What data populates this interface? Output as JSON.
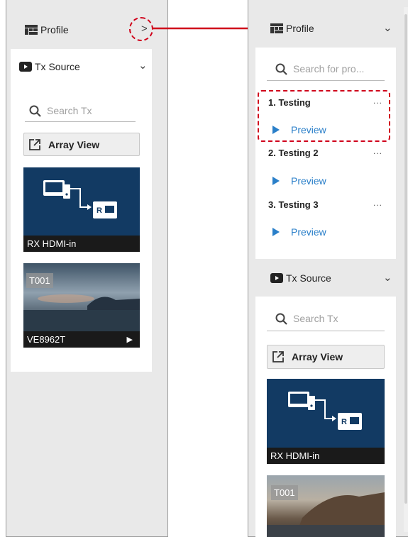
{
  "left": {
    "profile": {
      "label": "Profile",
      "chevron": ">"
    },
    "tx_source": {
      "label": "Tx Source",
      "chevron": "⌄"
    },
    "search": {
      "placeholder": "Search Tx"
    },
    "array_view": {
      "label": "Array View"
    },
    "thumbs": [
      {
        "caption": "RX HDMI-in"
      },
      {
        "tag": "T001",
        "caption": "VE8962T",
        "play": "▶"
      }
    ]
  },
  "right": {
    "profile": {
      "label": "Profile",
      "chevron": "⌄"
    },
    "search": {
      "placeholder": "Search for pro..."
    },
    "profiles": [
      {
        "name": "1. Testing",
        "more": "...",
        "preview": "Preview"
      },
      {
        "name": "2. Testing 2",
        "more": "...",
        "preview": "Preview"
      },
      {
        "name": "3. Testing 3",
        "more": "...",
        "preview": "Preview"
      }
    ],
    "tx_source": {
      "label": "Tx Source",
      "chevron": "⌄"
    },
    "tx_search": {
      "placeholder": "Search Tx"
    },
    "array_view": {
      "label": "Array View"
    },
    "thumbs": [
      {
        "caption": "RX HDMI-in"
      },
      {
        "tag": "T001"
      }
    ]
  },
  "colors": {
    "accent_red": "#d0021b",
    "link_blue": "#2a7fc9",
    "thumb_blue": "#123a63"
  }
}
